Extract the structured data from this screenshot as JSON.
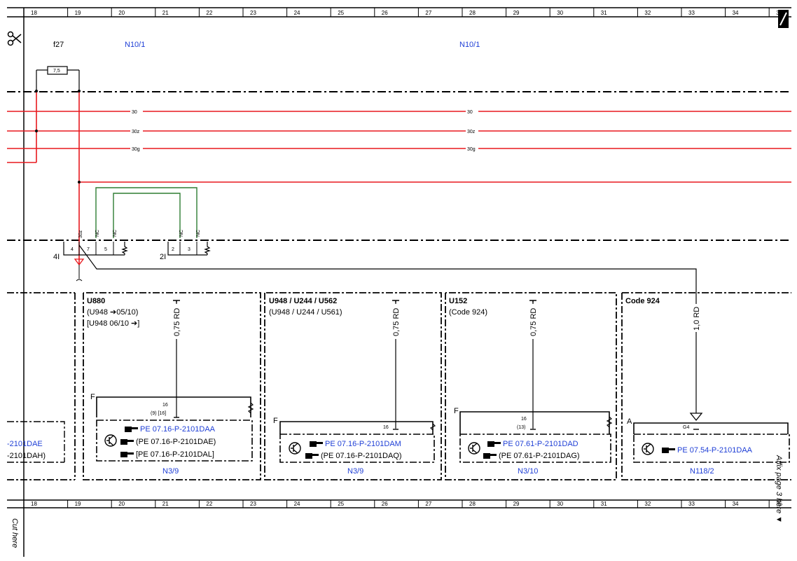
{
  "columns": [
    "18",
    "19",
    "20",
    "21",
    "22",
    "23",
    "24",
    "25",
    "26",
    "27",
    "28",
    "29",
    "30",
    "31",
    "32",
    "33",
    "34",
    "35"
  ],
  "fuse": {
    "name": "f27",
    "rating": "7,5"
  },
  "modules_top": [
    "N10/1",
    "N10/1"
  ],
  "bus_lines": [
    "30",
    "30z",
    "30g"
  ],
  "connector": {
    "left_pins": [
      "4",
      "7",
      "5"
    ],
    "right_pins": [
      "2",
      "3"
    ],
    "left_name": "4I",
    "right_name": "2I",
    "pin_tag_30z": "30z",
    "nc": "NC"
  },
  "sections": [
    {
      "title": "U880",
      "line2": "(U948 ➔05/10)",
      "line3": "[U948  06/10 ➔]",
      "wire": "0,75 RD",
      "pin": "16",
      "pin_sub": "(9) [16]",
      "side": "F",
      "refs": [
        "PE 07.16-P-2101DAA",
        "(PE 07.16-P-2101DAE)",
        "[PE 07.16-P-2101DAL]"
      ],
      "module": "N3/9"
    },
    {
      "title": "U948 / U244 / U562",
      "line2": "(U948 / U244 / U561)",
      "wire": "0,75 RD",
      "pin": "16",
      "side": "F",
      "refs": [
        "PE 07.16-P-2101DAM",
        "(PE 07.16-P-2101DAQ)"
      ],
      "module": "N3/9"
    },
    {
      "title": "U152",
      "line2": "(Code 924)",
      "wire": "0,75 RD",
      "pin": "16",
      "pin_sub": "(13)",
      "side": "F",
      "refs": [
        "PE 07.61-P-2101DAD",
        "(PE 07.61-P-2101DAG)"
      ],
      "module": "N3/10"
    },
    {
      "title": "Code 924",
      "wire": "1,0 RD",
      "pin": "G4",
      "side": "A",
      "refs": [
        "PE 07.54-P-2101DAA"
      ],
      "module": "N118/2"
    }
  ],
  "left_partial_refs": [
    "-2101DAE",
    "-2101DAH)"
  ],
  "margin": {
    "cut": "Cut here",
    "affix": "Affix page 3 here ▼"
  },
  "colors": {
    "power": "#e8191e",
    "ground_link": "#2e7d32",
    "ref_blue": "#1f3fd6"
  }
}
